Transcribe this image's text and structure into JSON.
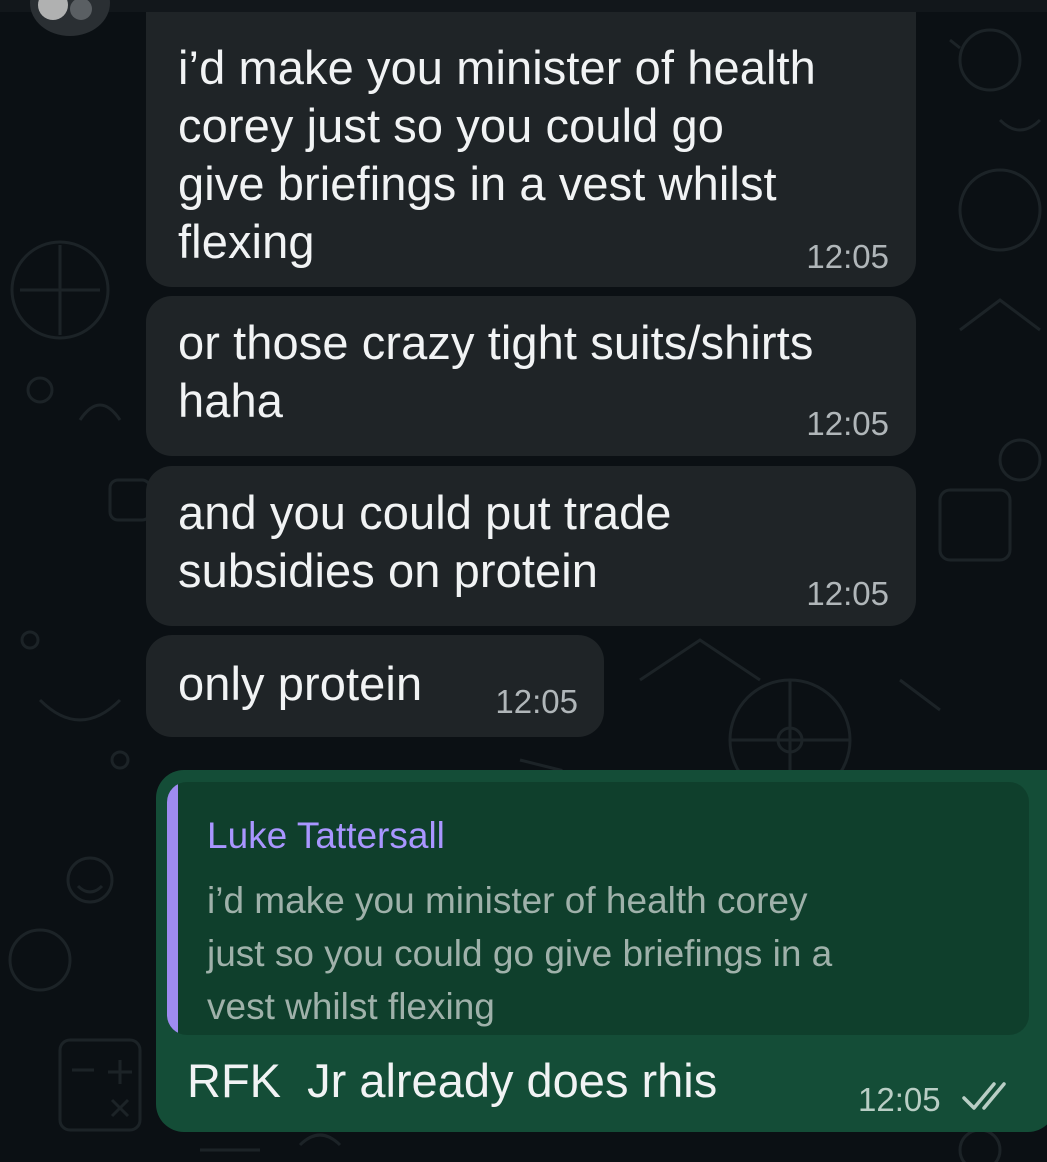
{
  "conversation": {
    "incoming": [
      {
        "text": "i’d make you minister of health\ncorey just so you could go\ngive briefings in a vest whilst\nflexing",
        "time": "12:05"
      },
      {
        "text": "or those crazy tight suits/shirts\nhaha",
        "time": "12:05"
      },
      {
        "text": "and you could put trade\nsubsidies on protein",
        "time": "12:05"
      },
      {
        "text": "only protein",
        "time": "12:05"
      }
    ],
    "outgoing": {
      "quote_author": "Luke Tattersall",
      "quote_text": "i’d make you minister of health corey\njust so you could go give briefings in a\nvest whilst flexing",
      "text": "RFK  Jr already does rhis",
      "time": "12:05",
      "status_icon": "double-check-icon"
    }
  },
  "colors": {
    "background": "#0b1014",
    "incoming_bubble": "#1f2427",
    "outgoing_bubble": "#144d37",
    "quote_accent": "#9e8bf0"
  }
}
